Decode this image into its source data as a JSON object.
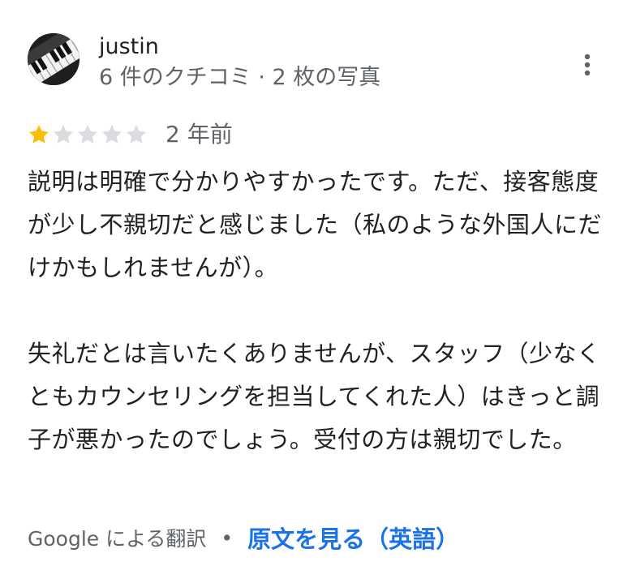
{
  "author": {
    "name": "justin",
    "meta": "6 件のクチコミ · 2 枚の写真"
  },
  "review": {
    "rating": 1,
    "max_rating": 5,
    "date": "2 年前",
    "text": "説明は明確で分かりやすかったです。ただ、接客態度が少し不親切だと感じました（私のような外国人にだけかもしれませんが）。\n\n失礼だとは言いたくありませんが、スタッフ（少なくともカウンセリングを担当してくれた人）はきっと調子が悪かったのでしょう。受付の方は親切でした。"
  },
  "footer": {
    "translated_by": "Google による翻訳",
    "separator": "•",
    "view_original": "原文を見る（英語）"
  },
  "colors": {
    "star_filled": "#fbbc04",
    "star_empty": "#dadce0",
    "link": "#1a73e8",
    "secondary_text": "#5f6368",
    "primary_text": "#202124"
  },
  "icons": {
    "more": "more-vert-icon",
    "star": "star-icon"
  }
}
